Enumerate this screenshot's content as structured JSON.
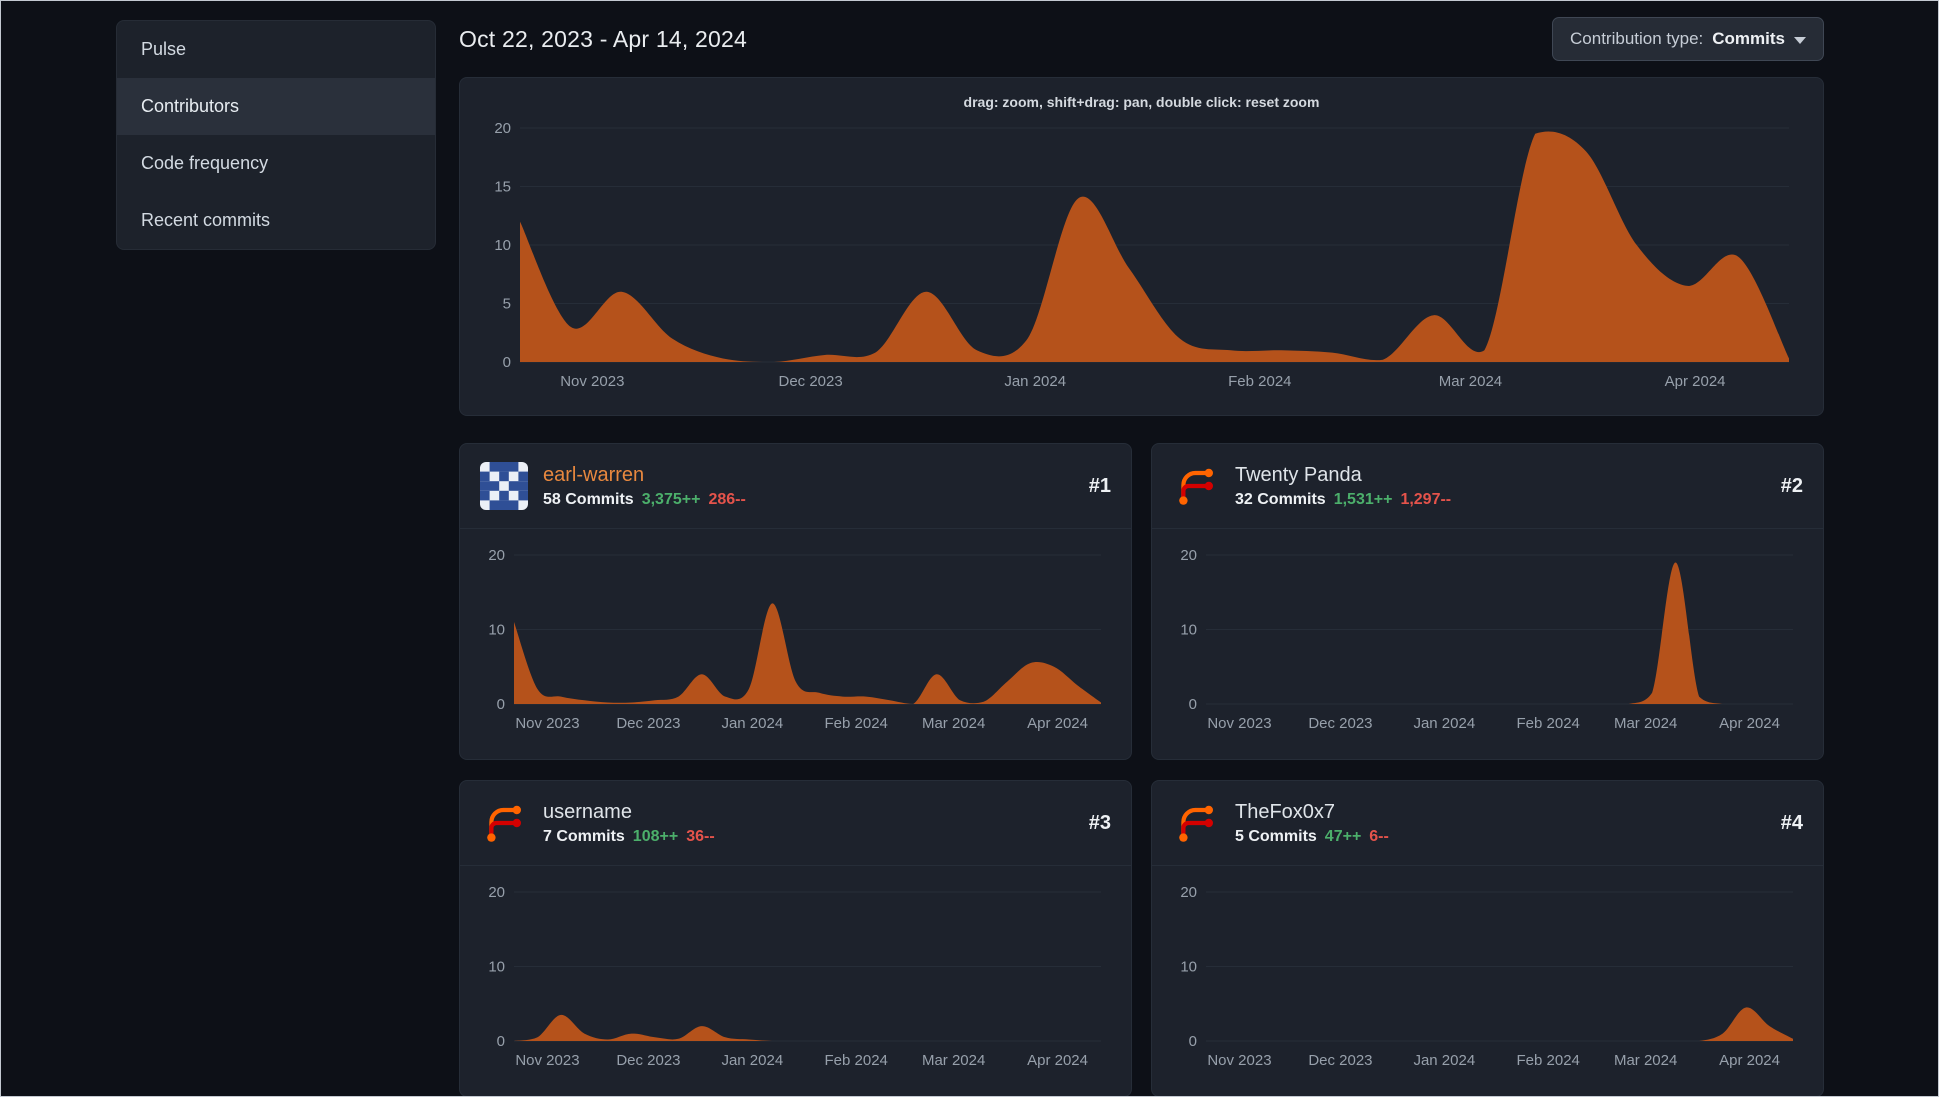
{
  "sidebar": {
    "items": [
      {
        "label": "Pulse",
        "active": false
      },
      {
        "label": "Contributors",
        "active": true
      },
      {
        "label": "Code frequency",
        "active": false
      },
      {
        "label": "Recent commits",
        "active": false
      }
    ]
  },
  "header": {
    "date_range": "Oct 22, 2023 - Apr 14, 2024",
    "contribution_type": {
      "label": "Contribution type:",
      "value": "Commits"
    }
  },
  "main_chart": {
    "hint": "drag: zoom, shift+drag: pan, double click: reset zoom"
  },
  "colors": {
    "area_fill": "#b5521b",
    "additions_green": "#4caf6b",
    "deletions_red": "#e5534b",
    "link_orange": "#e8883f",
    "name_default": "#dfe4e9"
  },
  "contributors": [
    {
      "name": "earl-warren",
      "name_color": "#e8883f",
      "rank": "#1",
      "commits": "58 Commits",
      "additions": "3,375++",
      "deletions": "286--",
      "avatar": "identicon"
    },
    {
      "name": "Twenty Panda",
      "name_color": "#dfe4e9",
      "rank": "#2",
      "commits": "32 Commits",
      "additions": "1,531++",
      "deletions": "1,297--",
      "avatar": "forgejo-logo"
    },
    {
      "name": "username",
      "name_color": "#dfe4e9",
      "rank": "#3",
      "commits": "7 Commits",
      "additions": "108++",
      "deletions": "36--",
      "avatar": "forgejo-logo"
    },
    {
      "name": "TheFox0x7",
      "name_color": "#dfe4e9",
      "rank": "#4",
      "commits": "5 Commits",
      "additions": "47++",
      "deletions": "6--",
      "avatar": "forgejo-logo"
    }
  ],
  "chart_data": [
    {
      "id": "main",
      "type": "area",
      "title": "Commits per week, all contributors",
      "x_range": [
        "Oct 22, 2023",
        "Apr 14, 2024"
      ],
      "ylim": [
        0,
        20
      ],
      "yticks": [
        0,
        5,
        10,
        15,
        20
      ],
      "grid": true,
      "fill": "#b5521b",
      "x_tick_labels": [
        "Nov 2023",
        "Dec 2023",
        "Jan 2024",
        "Feb 2024",
        "Mar 2024",
        "Apr 2024"
      ],
      "x_tick_pos": [
        0.057,
        0.229,
        0.406,
        0.583,
        0.749,
        0.926
      ],
      "values": [
        12,
        3,
        6,
        2,
        0.3,
        0,
        0.6,
        0.8,
        6,
        1,
        2,
        14,
        8,
        2,
        1,
        1,
        0.8,
        0.2,
        4,
        1,
        19.5,
        18,
        10,
        6.5,
        9,
        0.3
      ]
    },
    {
      "id": "earl-warren",
      "type": "area",
      "title": "Commits per week, earl-warren",
      "x_range": [
        "Oct 22, 2023",
        "Apr 14, 2024"
      ],
      "ylim": [
        0,
        20
      ],
      "yticks": [
        0,
        10,
        20
      ],
      "grid": true,
      "fill": "#b5521b",
      "x_tick_labels": [
        "Nov 2023",
        "Dec 2023",
        "Jan 2024",
        "Feb 2024",
        "Mar 2024",
        "Apr 2024"
      ],
      "x_tick_pos": [
        0.057,
        0.229,
        0.406,
        0.583,
        0.749,
        0.926
      ],
      "values": [
        11,
        2,
        1,
        0.5,
        0.2,
        0.2,
        0.5,
        1,
        4,
        1,
        2,
        13.5,
        3,
        1.5,
        1,
        1,
        0.5,
        0,
        4,
        0.5,
        0.3,
        3,
        5.5,
        5,
        2.5,
        0.2
      ]
    },
    {
      "id": "twenty-panda",
      "type": "area",
      "title": "Commits per week, Twenty Panda",
      "x_range": [
        "Oct 22, 2023",
        "Apr 14, 2024"
      ],
      "ylim": [
        0,
        20
      ],
      "yticks": [
        0,
        10,
        20
      ],
      "grid": true,
      "fill": "#b5521b",
      "x_tick_labels": [
        "Nov 2023",
        "Dec 2023",
        "Jan 2024",
        "Feb 2024",
        "Mar 2024",
        "Apr 2024"
      ],
      "x_tick_pos": [
        0.057,
        0.229,
        0.406,
        0.583,
        0.749,
        0.926
      ],
      "values": [
        0,
        0,
        0,
        0,
        0,
        0,
        0,
        0,
        0,
        0,
        0,
        0,
        0,
        0,
        0,
        0,
        0,
        0,
        0,
        1.5,
        19,
        1,
        0,
        0,
        0,
        0
      ]
    },
    {
      "id": "username",
      "type": "area",
      "title": "Commits per week, username",
      "x_range": [
        "Oct 22, 2023",
        "Apr 14, 2024"
      ],
      "ylim": [
        0,
        20
      ],
      "yticks": [
        0,
        10,
        20
      ],
      "grid": true,
      "fill": "#b5521b",
      "x_tick_labels": [
        "Nov 2023",
        "Dec 2023",
        "Jan 2024",
        "Feb 2024",
        "Mar 2024",
        "Apr 2024"
      ],
      "x_tick_pos": [
        0.057,
        0.229,
        0.406,
        0.583,
        0.749,
        0.926
      ],
      "values": [
        0,
        0.5,
        3.5,
        1,
        0.2,
        1,
        0.5,
        0.3,
        2,
        0.5,
        0.2,
        0,
        0,
        0,
        0,
        0,
        0,
        0,
        0,
        0,
        0,
        0,
        0,
        0,
        0,
        0
      ]
    },
    {
      "id": "thefox0x7",
      "type": "area",
      "title": "Commits per week, TheFox0x7",
      "x_range": [
        "Oct 22, 2023",
        "Apr 14, 2024"
      ],
      "ylim": [
        0,
        20
      ],
      "yticks": [
        0,
        10,
        20
      ],
      "grid": true,
      "fill": "#b5521b",
      "x_tick_labels": [
        "Nov 2023",
        "Dec 2023",
        "Jan 2024",
        "Feb 2024",
        "Mar 2024",
        "Apr 2024"
      ],
      "x_tick_pos": [
        0.057,
        0.229,
        0.406,
        0.583,
        0.749,
        0.926
      ],
      "values": [
        0,
        0,
        0,
        0,
        0,
        0,
        0,
        0,
        0,
        0,
        0,
        0,
        0,
        0,
        0,
        0,
        0,
        0,
        0,
        0,
        0,
        0,
        1,
        4.5,
        2,
        0.3
      ]
    }
  ]
}
